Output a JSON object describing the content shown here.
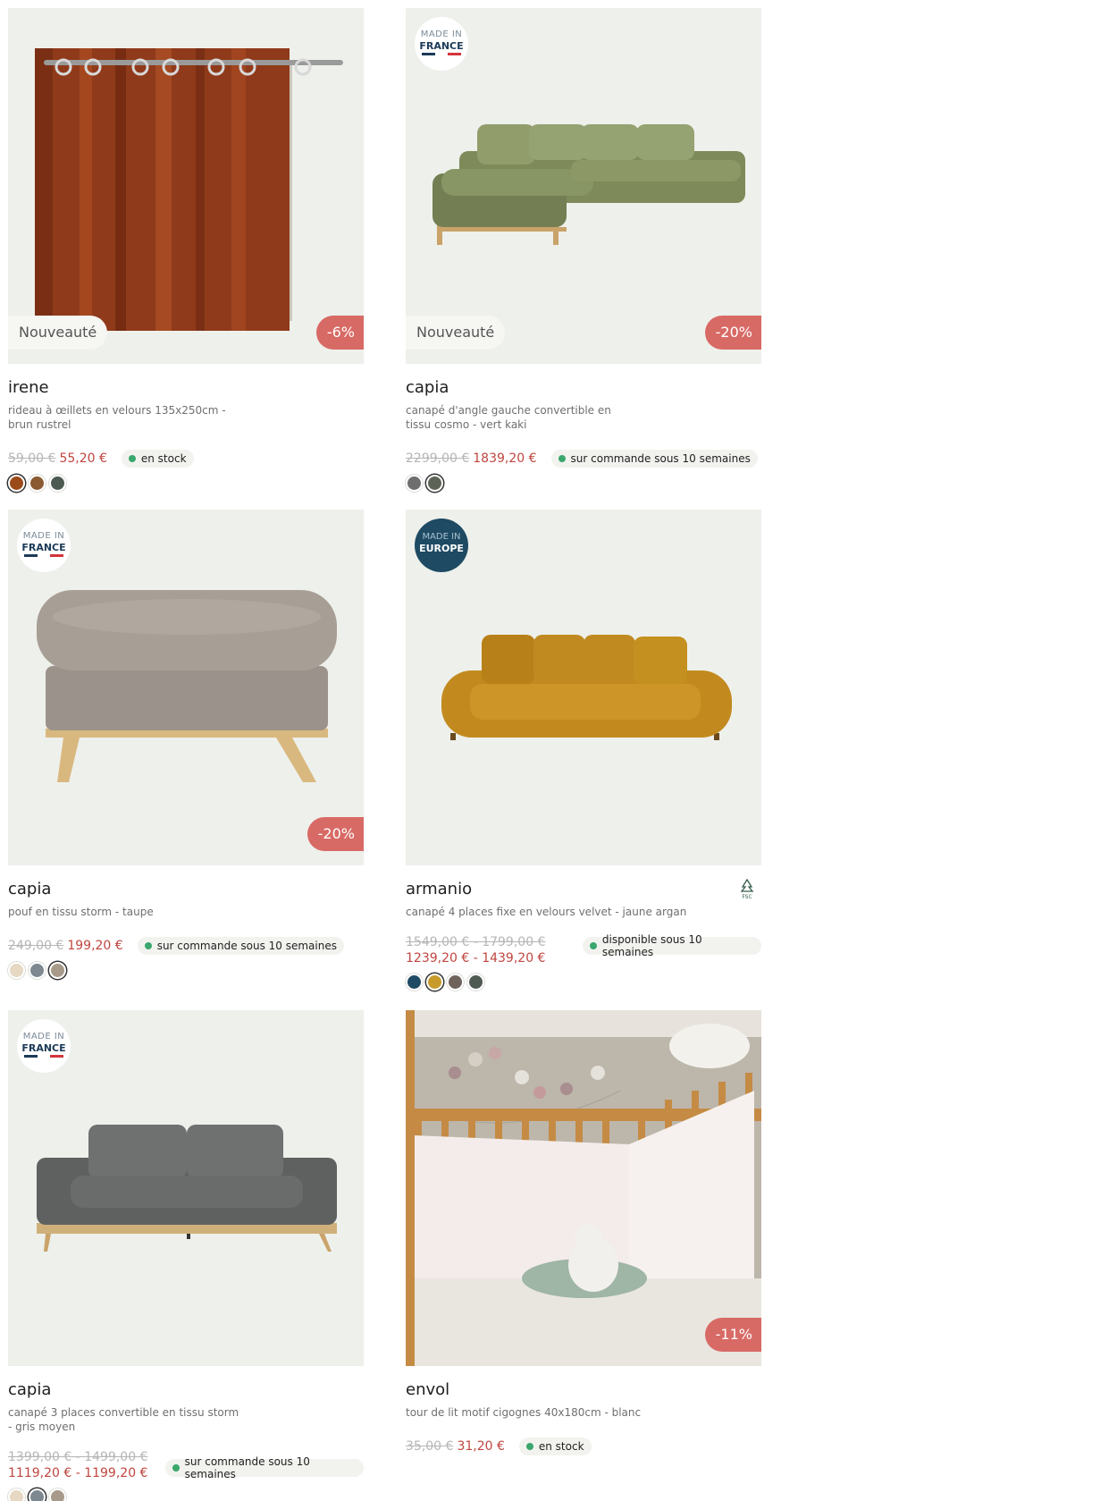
{
  "products": [
    {
      "name": "irene",
      "description": "rideau à œillets en velours 135x250cm - brun rustrel",
      "old_price": "59,00 €",
      "new_price": "55,20 €",
      "stock": "en stock",
      "badge_new": "Nouveauté",
      "discount": "-6%",
      "swatches": [
        "#9b4a1a",
        "#8b5a32",
        "#4d5a52"
      ]
    },
    {
      "name": "capia",
      "description": "canapé d'angle gauche convertible en tissu cosmo - vert kaki",
      "old_price": "2299,00 €",
      "new_price": "1839,20 €",
      "stock": "sur commande sous 10 semaines",
      "badge_new": "Nouveauté",
      "discount": "-20%",
      "label": {
        "line1": "MADE IN",
        "line2": "FRANCE"
      },
      "swatches": [
        "#6e6e6e",
        "#5d6356"
      ]
    },
    {
      "name": "capia",
      "description": "pouf en tissu storm - taupe",
      "old_price": "249,00 €",
      "new_price": "199,20 €",
      "stock": "sur commande sous 10 semaines",
      "discount": "-20%",
      "label": {
        "line1": "MADE IN",
        "line2": "FRANCE"
      },
      "swatches": [
        "#e6d8c3",
        "#7d8890",
        "#a89a8a"
      ]
    },
    {
      "name": "armanio",
      "description": "canapé 4 places fixe en velours velvet - jaune argan",
      "old_price": "1549,00 € - 1799,00 €",
      "new_price": "1239,20 € - 1439,20 €",
      "stock": "disponible sous 10 semaines",
      "label": {
        "line1": "MADE IN",
        "line2": "EUROPE"
      },
      "fsc": "FSC",
      "swatches": [
        "#1e4a63",
        "#c79a2a",
        "#6e625a",
        "#4e5a52"
      ]
    },
    {
      "name": "capia",
      "description": "canapé 3 places convertible en tissu storm - gris moyen",
      "old_price": "1399,00 € - 1499,00 €",
      "new_price": "1119,20 € - 1199,20 €",
      "stock": "sur commande sous 10 semaines",
      "label": {
        "line1": "MADE IN",
        "line2": "FRANCE"
      },
      "swatches": [
        "#e6d8c3",
        "#7d8890",
        "#a89a8a"
      ]
    },
    {
      "name": "envol",
      "description": "tour de lit motif cigognes 40x180cm - blanc",
      "old_price": "35,00 €",
      "new_price": "31,20 €",
      "stock": "en stock",
      "discount": "-11%"
    }
  ]
}
